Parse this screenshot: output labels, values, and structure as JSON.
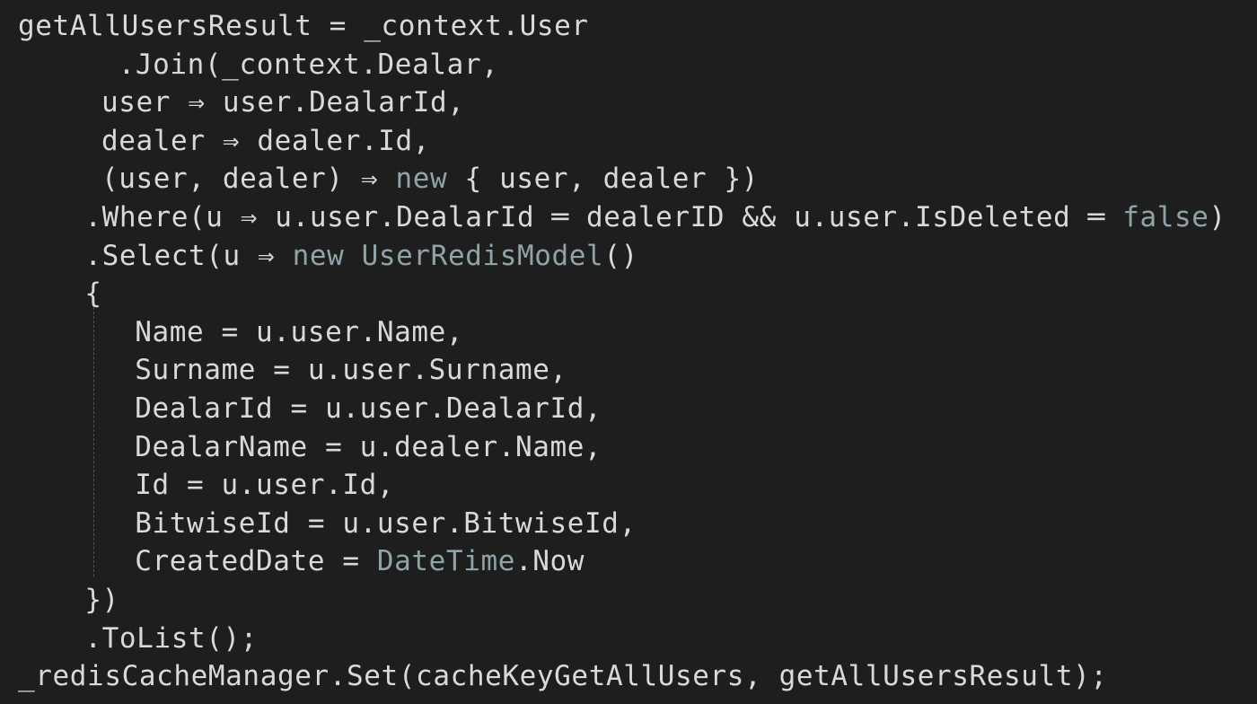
{
  "editor": {
    "theme": {
      "background": "#1e1e1e",
      "text": "#d9d9d9",
      "keyword": "#8fa3a8"
    },
    "lines": [
      {
        "indent": 0,
        "tokens": [
          {
            "text": "getAllUsersResult = _context.User",
            "kind": "plain"
          }
        ]
      },
      {
        "indent": 6,
        "tokens": [
          {
            "text": ".Join(_context.Dealar,",
            "kind": "plain"
          }
        ]
      },
      {
        "indent": 5,
        "tokens": [
          {
            "text": "user ⇒ user.DealarId,",
            "kind": "plain"
          }
        ]
      },
      {
        "indent": 5,
        "tokens": [
          {
            "text": "dealer ⇒ dealer.Id,",
            "kind": "plain"
          }
        ]
      },
      {
        "indent": 5,
        "tokens": [
          {
            "text": "(user, dealer) ⇒ ",
            "kind": "plain"
          },
          {
            "text": "new",
            "kind": "kw"
          },
          {
            "text": " { user, dealer })",
            "kind": "plain"
          }
        ]
      },
      {
        "indent": 4,
        "tokens": [
          {
            "text": ".Where(u ⇒ u.user.DealarId ═ dealerID && u.user.IsDeleted ═ ",
            "kind": "plain"
          },
          {
            "text": "false",
            "kind": "kw"
          },
          {
            "text": ")",
            "kind": "plain"
          }
        ]
      },
      {
        "indent": 4,
        "tokens": [
          {
            "text": ".Select(u ⇒ ",
            "kind": "plain"
          },
          {
            "text": "new",
            "kind": "kw"
          },
          {
            "text": " ",
            "kind": "plain"
          },
          {
            "text": "UserRedisModel",
            "kind": "type"
          },
          {
            "text": "()",
            "kind": "plain"
          }
        ]
      },
      {
        "indent": 4,
        "tokens": [
          {
            "text": "{",
            "kind": "plain"
          }
        ]
      },
      {
        "indent": 7,
        "tokens": [
          {
            "text": "Name = u.user.Name,",
            "kind": "plain"
          }
        ]
      },
      {
        "indent": 7,
        "tokens": [
          {
            "text": "Surname = u.user.Surname,",
            "kind": "plain"
          }
        ]
      },
      {
        "indent": 7,
        "tokens": [
          {
            "text": "DealarId = u.user.DealarId,",
            "kind": "plain"
          }
        ]
      },
      {
        "indent": 7,
        "tokens": [
          {
            "text": "DealarName = u.dealer.Name,",
            "kind": "plain"
          }
        ]
      },
      {
        "indent": 7,
        "tokens": [
          {
            "text": "Id = u.user.Id,",
            "kind": "plain"
          }
        ]
      },
      {
        "indent": 7,
        "tokens": [
          {
            "text": "BitwiseId = u.user.BitwiseId,",
            "kind": "plain"
          }
        ]
      },
      {
        "indent": 7,
        "tokens": [
          {
            "text": "CreatedDate = ",
            "kind": "plain"
          },
          {
            "text": "DateTime",
            "kind": "type"
          },
          {
            "text": ".Now",
            "kind": "plain"
          }
        ]
      },
      {
        "indent": 4,
        "tokens": [
          {
            "text": "})",
            "kind": "plain"
          }
        ]
      },
      {
        "indent": 4,
        "tokens": [
          {
            "text": ".ToList();",
            "kind": "plain"
          }
        ]
      },
      {
        "indent": 0,
        "tokens": [
          {
            "text": "_redisCacheManager.Set(cacheKeyGetAllUsers, getAllUsersResult);",
            "kind": "plain"
          }
        ]
      }
    ]
  }
}
